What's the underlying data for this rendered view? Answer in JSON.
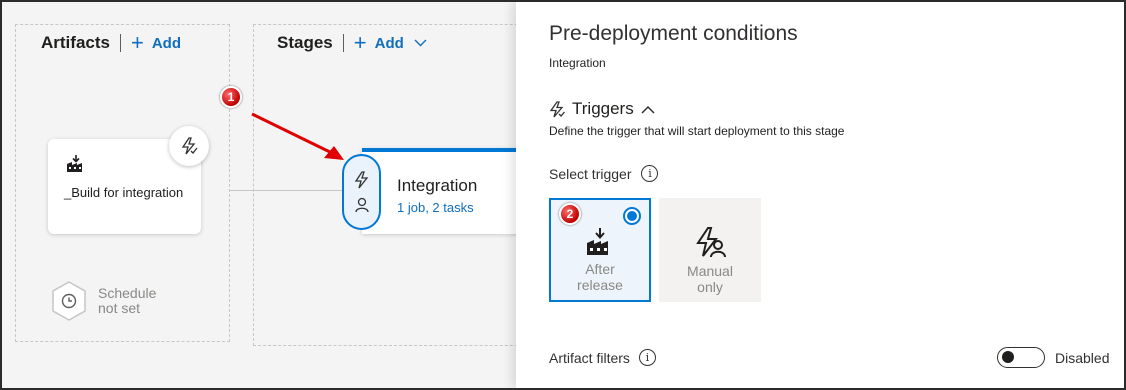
{
  "canvas": {
    "artifacts": {
      "title": "Artifacts",
      "add_label": "Add"
    },
    "stages": {
      "title": "Stages",
      "add_label": "Add"
    },
    "artifact_card": {
      "label": "_Build for integration"
    },
    "schedule": {
      "line1": "Schedule",
      "line2": "not set"
    },
    "stage_card": {
      "name": "Integration",
      "tasks": "1 job, 2 tasks"
    },
    "markers": [
      "1",
      "2"
    ]
  },
  "panel": {
    "title": "Pre-deployment conditions",
    "subtitle": "Integration",
    "section": {
      "title": "Triggers",
      "description": "Define the trigger that will start deployment to this stage"
    },
    "select_trigger_label": "Select trigger",
    "options": [
      {
        "line1": "After",
        "line2": "release",
        "selected": true,
        "icon": "build-release-icon"
      },
      {
        "line1": "Manual",
        "line2": "only",
        "selected": false,
        "icon": "manual-trigger-icon"
      }
    ],
    "artifact_filters_label": "Artifact filters",
    "toggle_label": "Disabled"
  },
  "colors": {
    "accent": "#0078d4",
    "link": "#106ebe",
    "marker": "#c00000"
  }
}
